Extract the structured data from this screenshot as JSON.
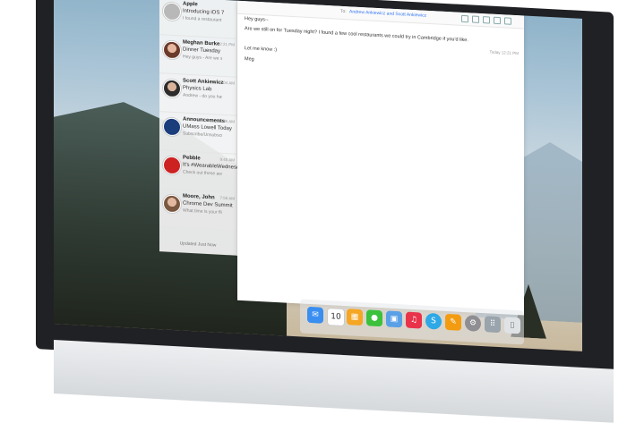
{
  "mail_list": {
    "items": [
      {
        "sender": "Apple",
        "subject": "Introducing iOS 7",
        "preview": "I found a restaurant named...",
        "time": ""
      },
      {
        "sender": "Meghan Burke",
        "subject": "Dinner Tuesday",
        "preview": "Hey guys - Are we still on for...",
        "time": "12:21 PM"
      },
      {
        "sender": "Scott Ankiewicz",
        "subject": "Physics Lab",
        "preview": "Andrew - do you have the...",
        "time": "11:04 AM"
      },
      {
        "sender": "Announcements",
        "subject": "UMass Lowell Today",
        "preview": "Subscribe/Unsubscribe...",
        "time": "10:06 AM"
      },
      {
        "sender": "Pebble",
        "subject": "It's #WearableWednesday",
        "preview": "Check out these awesome...",
        "time": "9:45 AM"
      },
      {
        "sender": "Moore, John",
        "subject": "Chrome Dev Summit",
        "preview": "What time is your flight on...",
        "time": "7:56 AM"
      }
    ],
    "updated": "Updated Just Now"
  },
  "message": {
    "to_label": "To:",
    "to_value": "Andrew Ankiewicz and Scott Ankiewicz",
    "greeting": "Hey guys--",
    "line1": "Are we still on for Tuesday night? I found a few cool restaurants we could try in Cambridge if you'd like.",
    "date": "Today 12:21 PM",
    "line2": "Let me know :)",
    "signature": "Meg"
  },
  "dock": {
    "calendar_day": "10",
    "items": [
      "mail-icon",
      "calendar-icon",
      "photos-icon",
      "messages-icon",
      "preview-icon",
      "music-icon",
      "skype-icon",
      "pages-icon",
      "settings-icon",
      "launchpad-icon",
      "trash-icon"
    ]
  },
  "colors": {
    "accent": "#3478f6",
    "bezel": "#202124"
  }
}
